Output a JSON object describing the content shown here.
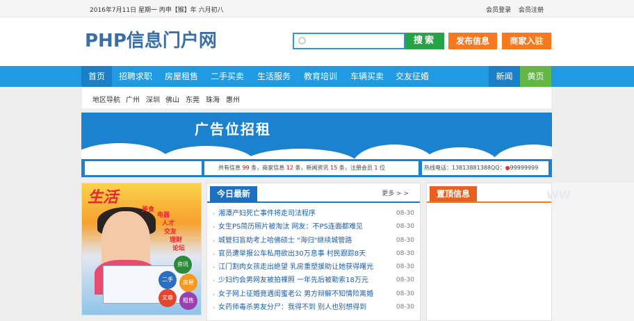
{
  "topbar": {
    "date": "2016年7月11日 星期一 丙申【猴】年 六月初八",
    "login": "会员登录",
    "register": "会员注册"
  },
  "header": {
    "logo": "PHP信息门户网",
    "search_placeholder": "",
    "search_button": "搜索",
    "publish_button": "发布信息",
    "merchant_button": "商家入驻"
  },
  "nav": {
    "items": [
      "首页",
      "招聘求职",
      "房屋租售",
      "二手买卖",
      "生活服务",
      "教育培训",
      "车辆买卖",
      "交友征婚"
    ],
    "right_items": [
      "新闻",
      "黄页"
    ]
  },
  "region": {
    "label": "地区导航",
    "cities": [
      "广州",
      "深圳",
      "佛山",
      "东莞",
      "珠海",
      "惠州"
    ]
  },
  "banner": {
    "title": "广告位招租"
  },
  "stats": {
    "p1": "共有信息",
    "info_count": "99",
    "p2": "条，商家信息",
    "merchant_count": "12",
    "p3": "条，新闻资讯",
    "news_count": "15",
    "p4": "条，注册会员",
    "member_count": "1",
    "p5": "位",
    "hotline": "热线电话：13813881388QQ：",
    "qq": "99999999"
  },
  "ad_image": {
    "big_text": "生活",
    "tags": [
      "美食",
      "电器",
      "人才",
      "交友",
      "理财",
      "论坛",
      "资讯",
      "二手",
      "文章",
      "房屋",
      "租售",
      "服务",
      "招聘"
    ]
  },
  "today_news": {
    "title": "今日最新",
    "more": "更多 > >",
    "items": [
      {
        "title": "湘潭产妇死亡事件将走司法程序",
        "date": "08-30"
      },
      {
        "title": "女生PS简历照片被淘汰 网友：不PS连面都难见",
        "date": "08-30"
      },
      {
        "title": "城管扫盲助考上哈佛硕士 \"海归\"继续城管路",
        "date": "08-30"
      },
      {
        "title": "官员遭举报公车私用欲出30万息事 村民跟踪8天",
        "date": "08-30"
      },
      {
        "title": "江门割肉女孩走出绝望 乳房重塑援助让她获得曙光",
        "date": "08-30"
      },
      {
        "title": "少妇约会男网友被拍裸照 一年先后被勒索18万元",
        "date": "08-30"
      },
      {
        "title": "女子网上征婚竟遇闺蜜老公 男方辩解不知情险离婚",
        "date": "08-30"
      },
      {
        "title": "女药师毒杀男友分尸：我得不到 别人也别想得到",
        "date": "08-30"
      }
    ]
  },
  "top_info": {
    "title": "置顶信息"
  },
  "colors": {
    "nav_blue": "#1f9ae3",
    "logo_blue": "#3a6fa5",
    "search_green": "#27a347",
    "button_orange": "#f7791e",
    "yellow_page_green": "#63b744"
  }
}
